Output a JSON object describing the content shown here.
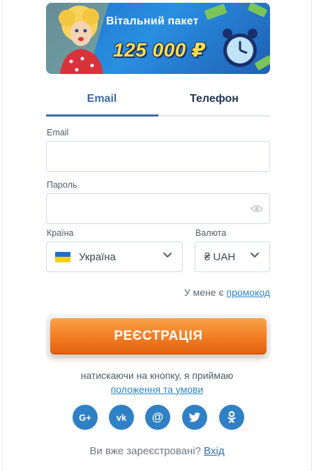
{
  "banner": {
    "title": "Вітальний пакет",
    "amount": "125 000 ₽"
  },
  "tabs": [
    {
      "label": "Email",
      "active": true
    },
    {
      "label": "Телефон",
      "active": false
    }
  ],
  "form": {
    "email_label": "Email",
    "email_value": "",
    "password_label": "Пароль",
    "password_value": "",
    "country_label": "Країна",
    "country_value": "Україна",
    "currency_label": "Валюта",
    "currency_value": "₴ UAH"
  },
  "promo": {
    "prefix": "У мене є",
    "link": "промокод"
  },
  "register_button": "РЕЄСТРАЦІЯ",
  "terms": {
    "text": "натискаючи на кнопку, я приймаю",
    "link": "положення та умови"
  },
  "socials": [
    {
      "icon": "google-plus-icon",
      "glyph": "G+"
    },
    {
      "icon": "vk-icon",
      "glyph": "vk"
    },
    {
      "icon": "mail-icon",
      "glyph": "@"
    },
    {
      "icon": "twitter-icon",
      "glyph": ""
    },
    {
      "icon": "odnoklassniki-icon",
      "glyph": ""
    }
  ],
  "login": {
    "prefix": "Ви вже зареєстровані?",
    "link": "Вхід"
  },
  "colors": {
    "accent": "#3b6aa8",
    "link": "#2b86c5",
    "button_orange": "#f07c22",
    "social": "#2f80c4"
  }
}
